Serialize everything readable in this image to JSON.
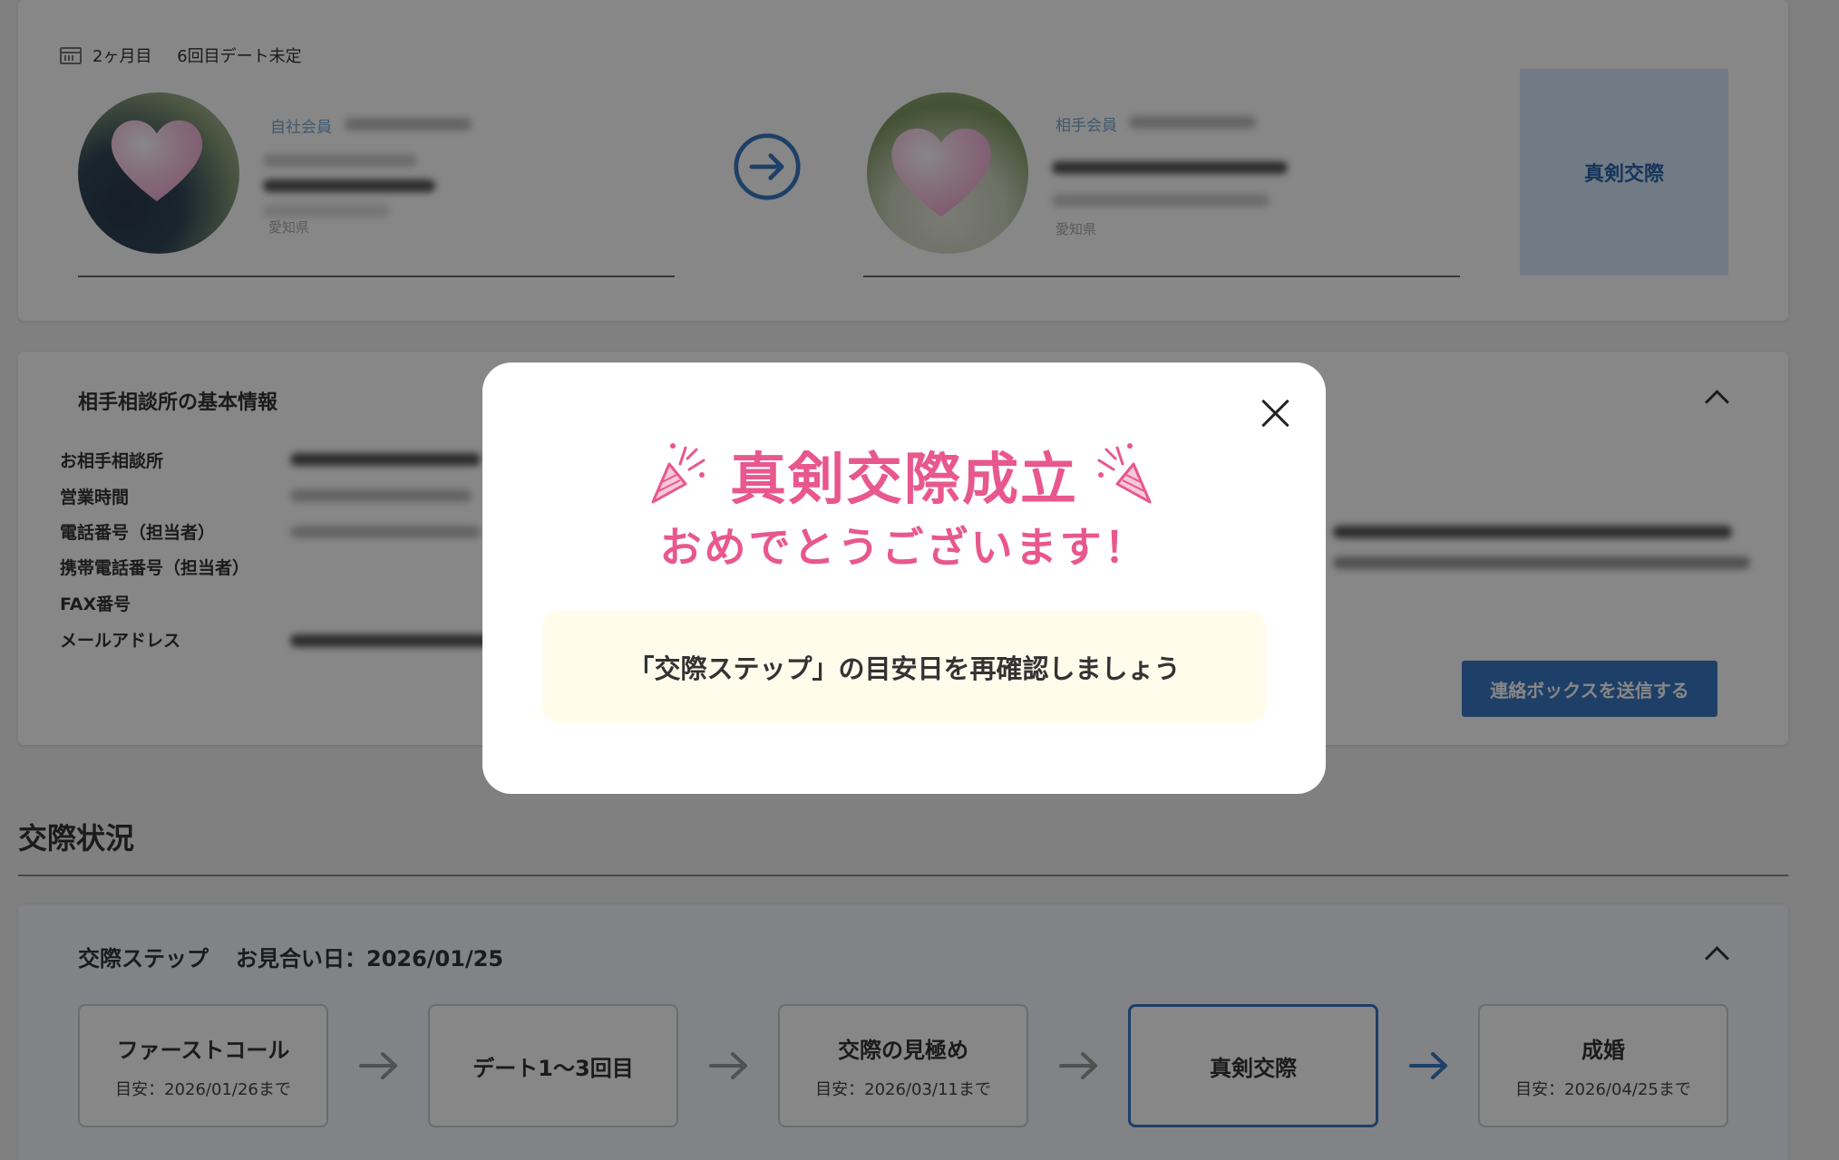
{
  "couple": {
    "period": "2ヶ月目",
    "date_status": "6回目デート未定",
    "self_label": "自社会員",
    "self_pref": "愛知県",
    "partner_label": "相手会員",
    "partner_pref": "愛知県",
    "relationship_status": "真剣交際"
  },
  "basic_info": {
    "title": "相手相談所の基本情報",
    "labels": [
      "お相手相談所",
      "営業時間",
      "電話番号（担当者）",
      "携帯電話番号（担当者）",
      "FAX番号",
      "メールアドレス"
    ],
    "send_button": "連絡ボックスを送信する"
  },
  "status": {
    "title": "交際状況",
    "step_title": "交際ステップ",
    "meeting_date": "お見合い日：2026/01/25",
    "steps": [
      {
        "label": "ファーストコール",
        "date": "目安：2026/01/26まで"
      },
      {
        "label": "デート1〜3回目",
        "date": ""
      },
      {
        "label": "交際の見極め",
        "date": "目安：2026/03/11まで"
      },
      {
        "label": "真剣交際",
        "date": ""
      },
      {
        "label": "成婚",
        "date": "目安：2026/04/25まで"
      }
    ]
  },
  "modal": {
    "title": "真剣交際成立",
    "subtitle": "おめでとうございます！",
    "notice": "「交際ステップ」の目安日を再確認しましょう"
  },
  "colors": {
    "accent_blue": "#3a78c2",
    "pink": "#e8578d",
    "notice_bg": "#fffcec"
  }
}
